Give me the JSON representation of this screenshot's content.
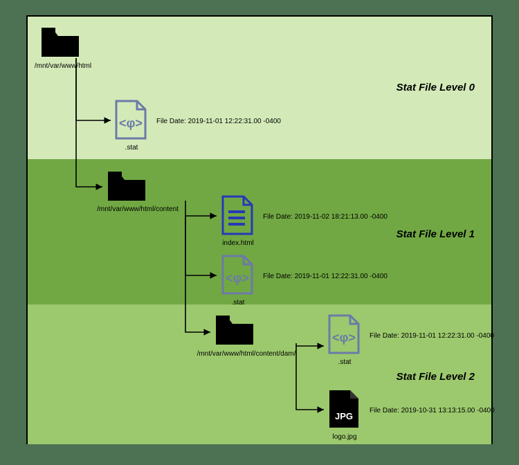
{
  "levels": {
    "level0": {
      "title": "Stat File Level 0"
    },
    "level1": {
      "title": "Stat File Level 1"
    },
    "level2": {
      "title": "Stat File Level 2"
    }
  },
  "folders": {
    "root": {
      "path": "/mnt/var/www/html"
    },
    "content": {
      "path": "/mnt/var/www/html/content"
    },
    "dam": {
      "path": "/mnt/var/www/html/content/dam/"
    }
  },
  "files": {
    "stat0": {
      "name": ".stat",
      "date": "File Date: 2019-11-01 12:22:31.00 -0400"
    },
    "index": {
      "name": "index.html",
      "date": "File Date: 2019-11-02 18:21:13.00 -0400"
    },
    "stat1": {
      "name": ".stat",
      "date": "File Date: 2019-11-01 12:22:31.00 -0400"
    },
    "stat2": {
      "name": ".stat",
      "date": "File Date: 2019-11-01 12:22:31.00 -0400"
    },
    "logo": {
      "name": "logo.jpg",
      "date": "File Date: 2019-10-31 13:13:15.00 -0400"
    }
  }
}
